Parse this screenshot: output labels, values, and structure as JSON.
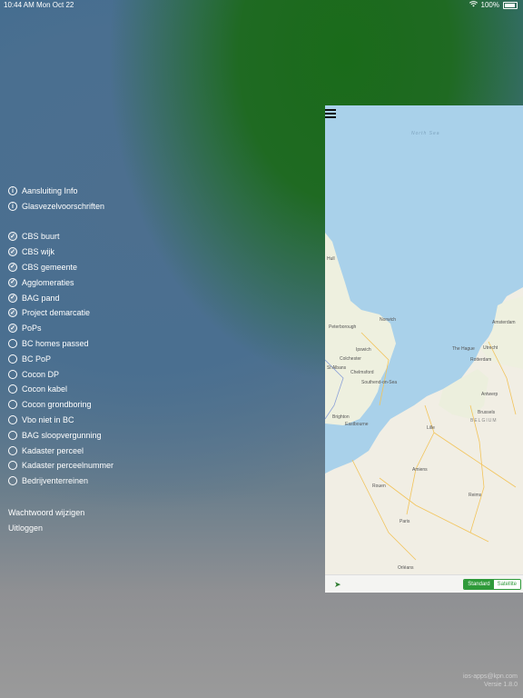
{
  "status_bar": {
    "time": "10:44 AM",
    "date": "Mon Oct 22",
    "battery": "100%"
  },
  "menu": {
    "info_items": [
      {
        "label": "Aansluiting Info"
      },
      {
        "label": "Glasvezelvoorschriften"
      }
    ],
    "layers": [
      {
        "label": "CBS buurt",
        "checked": true
      },
      {
        "label": "CBS wijk",
        "checked": true
      },
      {
        "label": "CBS gemeente",
        "checked": true
      },
      {
        "label": "Agglomeraties",
        "checked": true
      },
      {
        "label": "BAG pand",
        "checked": true
      },
      {
        "label": "Project demarcatie",
        "checked": true
      },
      {
        "label": "PoPs",
        "checked": true
      },
      {
        "label": "BC homes passed",
        "checked": false
      },
      {
        "label": "BC PoP",
        "checked": false
      },
      {
        "label": "Cocon DP",
        "checked": false
      },
      {
        "label": "Cocon kabel",
        "checked": false
      },
      {
        "label": "Cocon grondboring",
        "checked": false
      },
      {
        "label": "Vbo niet in BC",
        "checked": false
      },
      {
        "label": "BAG sloopvergunning",
        "checked": false
      },
      {
        "label": "Kadaster perceel",
        "checked": false
      },
      {
        "label": "Kadaster perceelnummer",
        "checked": false
      },
      {
        "label": "Bedrijventerreinen",
        "checked": false
      }
    ],
    "account": {
      "change_password": "Wachtwoord wijzigen",
      "logout": "Uitloggen"
    }
  },
  "map": {
    "map_type": {
      "standard": "Standard",
      "satellite": "Satellite"
    },
    "labels": {
      "north_sea": "North Sea",
      "hull": "Hull",
      "peterborough": "Peterborough",
      "norwich": "Norwich",
      "ipswich": "Ipswich",
      "colchester": "Colchester",
      "st_albans": "St Albans",
      "chelmsford": "Chelmsford",
      "southend": "Southend-on-Sea",
      "brighton": "Brighton",
      "eastbourne": "Eastbourne",
      "amsterdam": "Amsterdam",
      "the_hague": "The Hague",
      "utrecht": "Utrecht",
      "rotterdam": "Rotterdam",
      "antwerp": "Antwerp",
      "brussels": "Brussels",
      "belgium": "BELGIUM",
      "lille": "Lille",
      "amiens": "Amiens",
      "rouen": "Rouen",
      "reims": "Reims",
      "paris": "Paris",
      "orleans": "Orléans"
    }
  },
  "footer": {
    "email": "ios-apps@kpn.com",
    "version": "Versie 1.8.0"
  }
}
